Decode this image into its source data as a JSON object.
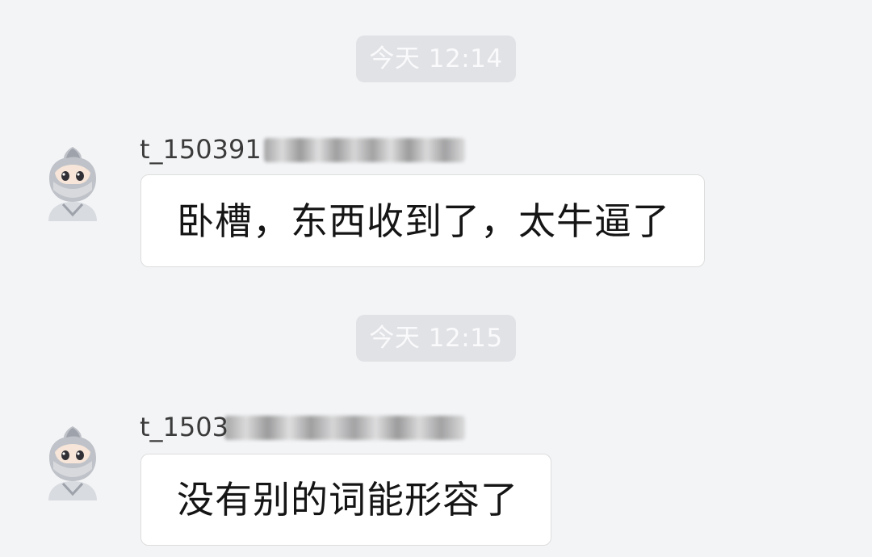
{
  "chat": {
    "messages": [
      {
        "time": "今天 12:14",
        "sender": "t_150391",
        "text": "卧槽，东西收到了，太牛逼了"
      },
      {
        "time": "今天 12:15",
        "sender": "t_1503",
        "text": "没有别的词能形容了"
      }
    ]
  },
  "avatar": {
    "icon": "ninja-avatar-icon",
    "colors": {
      "head": "#bfc2c8",
      "hood_dark": "#9ea2aa",
      "face": "#f6e5d8",
      "mask": "#d7d9dd",
      "eyes": "#2f2f35",
      "body": "#d8dbe0"
    }
  }
}
